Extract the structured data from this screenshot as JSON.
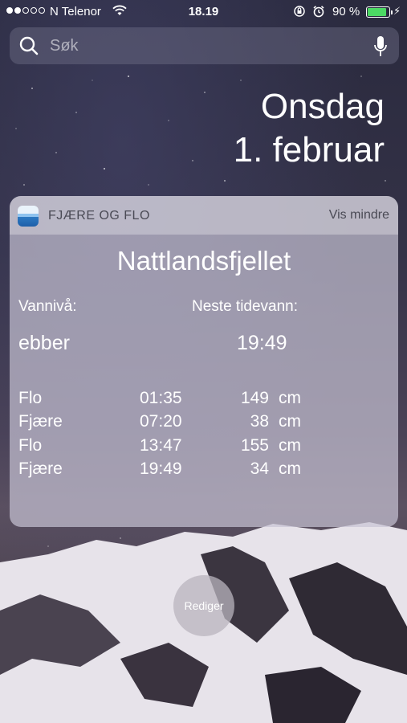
{
  "status_bar": {
    "signal_dots": 5,
    "signal_filled": 2,
    "carrier": "N Telenor",
    "time": "18.19",
    "battery": "90 %",
    "battery_level": 0.9,
    "icons": [
      "signal-icon",
      "wifi-icon",
      "rotation-lock-icon",
      "alarm-icon",
      "battery-icon",
      "charging-icon"
    ]
  },
  "search": {
    "placeholder": "Søk"
  },
  "date": {
    "weekday": "Onsdag",
    "day": "1. februar"
  },
  "widget": {
    "app_name": "FJÆRE OG FLO",
    "toggle_label": "Vis mindre",
    "location": "Nattlandsfjellet",
    "water_level_label": "Vannivå:",
    "next_tide_label": "Neste tidevann:",
    "water_level": "ebber",
    "next_tide": "19:49",
    "tides": [
      {
        "type": "Flo",
        "time": "01:35",
        "height": "149",
        "unit": "cm"
      },
      {
        "type": "Fjære",
        "time": "07:20",
        "height": "38",
        "unit": "cm"
      },
      {
        "type": "Flo",
        "time": "13:47",
        "height": "155",
        "unit": "cm"
      },
      {
        "type": "Fjære",
        "time": "19:49",
        "height": "34",
        "unit": "cm"
      }
    ]
  },
  "edit_button": {
    "label": "Rediger"
  },
  "colors": {
    "battery_fill": "#4cd964"
  }
}
